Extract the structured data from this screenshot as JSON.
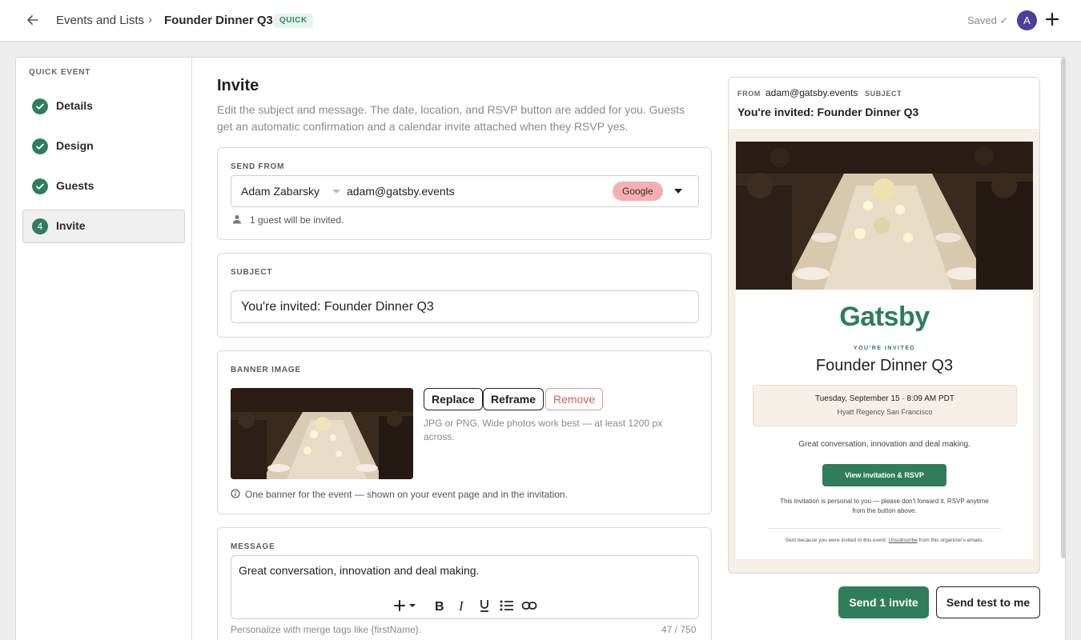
{
  "header": {
    "breadcrumb_parent": "Events and Lists",
    "breadcrumb_separator": "›",
    "breadcrumb_current": "Founder Dinner Q3",
    "badge": "QUICK",
    "saved_status": "Saved ✓",
    "avatar_initial": "A"
  },
  "sidebar": {
    "heading": "QUICK EVENT",
    "steps": [
      {
        "label": "Details",
        "state": "done"
      },
      {
        "label": "Design",
        "state": "done"
      },
      {
        "label": "Guests",
        "state": "done"
      },
      {
        "label": "Invite",
        "number": "4",
        "state": "active"
      }
    ]
  },
  "main": {
    "title": "Invite",
    "description": "Edit the subject and message. The date, location, and RSVP button are added for you. Guests get an automatic confirmation and a calendar invite attached when they RSVP yes.",
    "send_from": {
      "label": "SEND FROM",
      "name": "Adam Zabarsky",
      "email": "adam@gatsby.events",
      "provider": "Google",
      "guest_note": "1 guest will be invited."
    },
    "subject": {
      "label": "SUBJECT",
      "value": "You're invited: Founder Dinner Q3"
    },
    "banner": {
      "label": "BANNER IMAGE",
      "replace": "Replace",
      "reframe": "Reframe",
      "remove": "Remove",
      "help": "JPG or PNG. Wide photos work best — at least 1200 px across.",
      "note": "One banner for the event — shown on your event page and in the invitation."
    },
    "message": {
      "label": "MESSAGE",
      "value": "Great conversation, innovation and deal making.",
      "hint": "Personalize with merge tags like {firstName}.",
      "count": "47 / 750"
    }
  },
  "preview": {
    "from_label": "FROM",
    "from": "adam@gatsby.events",
    "subject_label": "SUBJECT",
    "subject": "You're invited: Founder Dinner Q3",
    "logo": "Gatsby",
    "invited": "YOU'RE INVITED",
    "event_title": "Founder Dinner Q3",
    "date": "Tuesday, September 15 · 8:09 AM PDT",
    "venue": "Hyatt Regency San Francisco",
    "message": "Great conversation, innovation and deal making.",
    "cta": "View invitation & RSVP",
    "personal_note": "This invitation is personal to you — please don't forward it. RSVP anytime from the button above.",
    "footer_before": "Sent because you were invited to this event.",
    "footer_link": "Unsubscribe",
    "footer_after": "from this organizer's emails."
  },
  "actions": {
    "send": "Send 1 invite",
    "test": "Send test to me"
  },
  "colors": {
    "accent": "#2f7d5b",
    "google_pill": "#f4b0b0",
    "remove": "#d65a5a"
  }
}
